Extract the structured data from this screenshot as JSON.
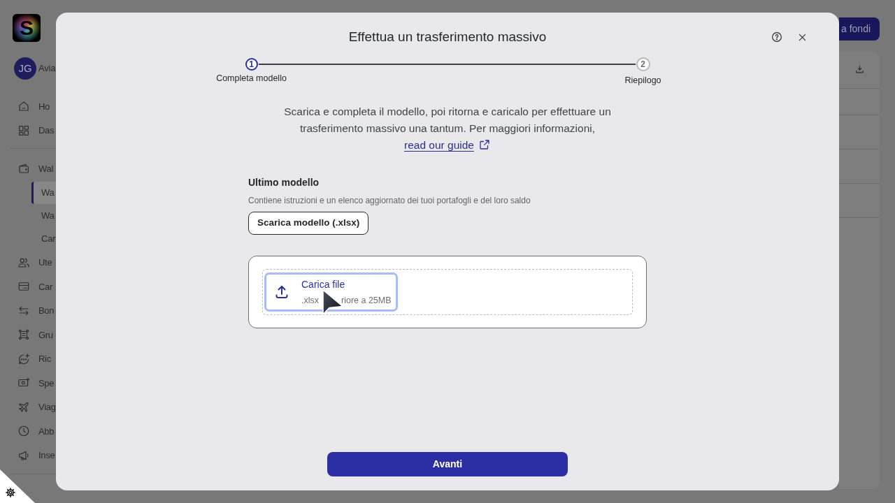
{
  "sidebar": {
    "logo": "S",
    "user": {
      "initials": "JG",
      "name": "Avia"
    },
    "sections": [
      {
        "items": [
          {
            "label": "Ho",
            "selected": false
          },
          {
            "label": "Das",
            "selected": false
          }
        ]
      },
      {
        "items": [
          {
            "label": "Wal",
            "selected": false,
            "children": [
              {
                "label": "Wa",
                "selected": true
              },
              {
                "label": "Wa",
                "selected": false
              },
              {
                "label": "Car",
                "selected": false
              }
            ]
          },
          {
            "label": "Ute",
            "selected": false
          },
          {
            "label": "Car",
            "selected": false
          },
          {
            "label": "Bon",
            "selected": false
          },
          {
            "label": "Gru",
            "selected": false
          },
          {
            "label": "Ric",
            "selected": false
          },
          {
            "label": "Spe",
            "selected": false
          },
          {
            "label": "Viag",
            "selected": false
          },
          {
            "label": "Abb",
            "selected": false
          },
          {
            "label": "Inse",
            "selected": false
          }
        ]
      }
    ]
  },
  "header": {
    "button": "a fondi"
  },
  "modal": {
    "title": "Effettua un trasferimento massivo",
    "steps": [
      {
        "number": "1",
        "label": "Completa modello",
        "selected": true
      },
      {
        "number": "2",
        "label": "Riepilogo",
        "selected": false
      }
    ],
    "intro": "Scarica e completa il modello, poi ritorna e caricalo per effettuare un trasferimento massivo una tantum. Per maggiori informazioni,",
    "guide_link": "read our guide",
    "template": {
      "title": "Ultimo modello",
      "description": "Contiene istruzioni e un elenco aggiornato dei tuoi portafogli e del loro saldo",
      "button": "Scarica modello (.xlsx)"
    },
    "upload": {
      "label": "Carica file",
      "hint_parts": [
        ".xlsx",
        "riore a 25MB"
      ],
      "focused": true
    },
    "next_button": "Avanti"
  }
}
